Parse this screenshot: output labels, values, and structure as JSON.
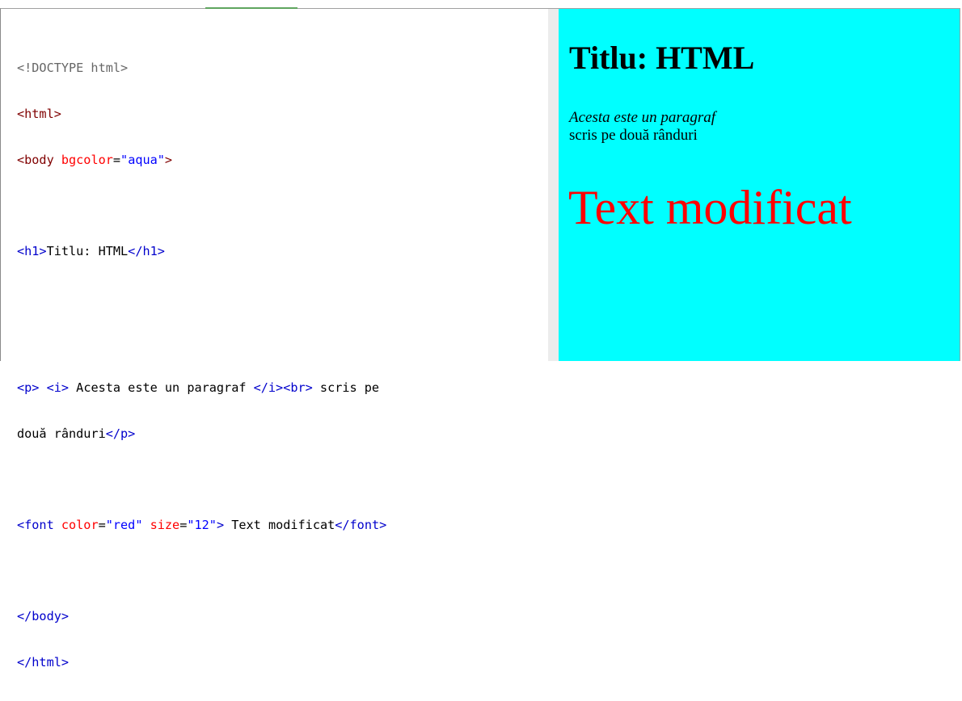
{
  "editor": {
    "lines": {
      "doctype": "<!DOCTYPE html>",
      "html_open": "<html>",
      "body_tag": "<body",
      "body_attr": "bgcolor",
      "eq": "=",
      "body_val": "\"aqua\"",
      "close": ">",
      "h1_open": "<h1>",
      "h1_text": "Titlu: HTML",
      "h1_close": "</h1>",
      "p_open": "<p>",
      "i_open": "<i>",
      "p_text1": " Acesta este un paragraf ",
      "i_close": "</i>",
      "br": "<br>",
      "p_text2": " scris pe",
      "p_text3": "două rânduri",
      "p_close": "</p>",
      "font_tag": "<font",
      "color_attr": "color",
      "color_val": "\"red\"",
      "size_attr": "size",
      "size_val": "\"12\"",
      "font_text": " Text modificat",
      "font_close": "</font>",
      "body_close": "</body>",
      "html_close": "</html>",
      "space": " "
    }
  },
  "preview": {
    "heading": "Titlu: HTML",
    "para_italic": "Acesta este un paragraf",
    "para_rest": "scris pe două rânduri",
    "font_text": "Text modificat",
    "background": "#00ffff",
    "font_color": "#ff0000"
  }
}
